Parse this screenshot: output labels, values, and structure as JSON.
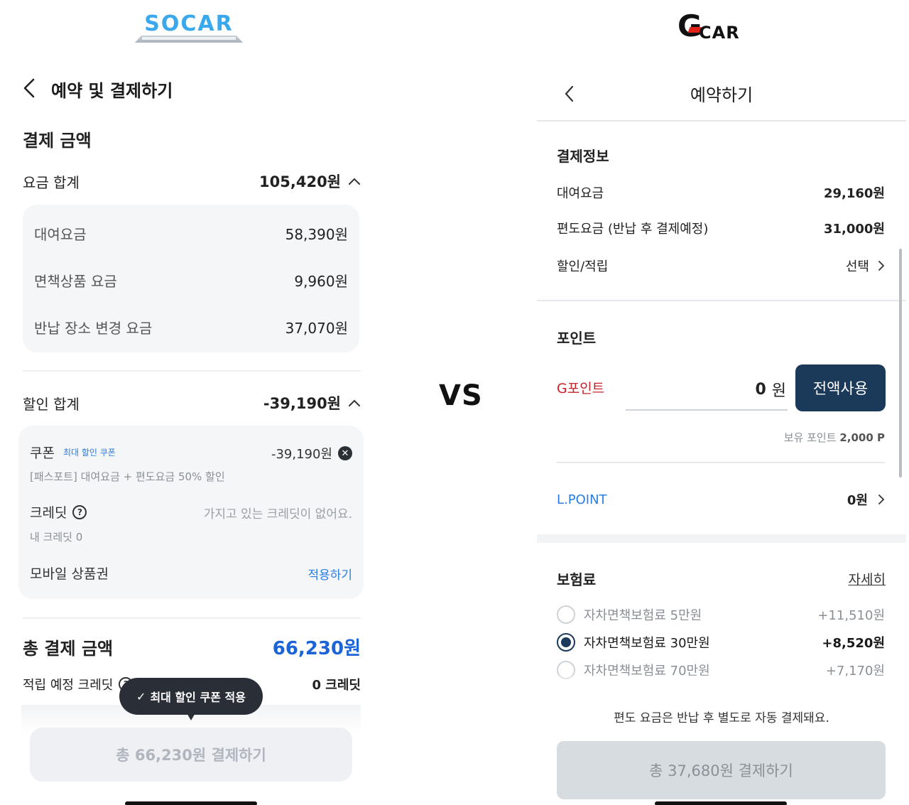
{
  "vs_label": "VS",
  "socar": {
    "logo_text": "SOCAR",
    "header_title": "예약 및 결제하기",
    "section_title": "결제 금액",
    "fee_total": {
      "label": "요금 합계",
      "amount": "105,420원"
    },
    "fee_items": [
      {
        "label": "대여요금",
        "amount": "58,390원"
      },
      {
        "label": "면책상품 요금",
        "amount": "9,960원"
      },
      {
        "label": "반납 장소 변경 요금",
        "amount": "37,070원"
      }
    ],
    "discount_total": {
      "label": "할인 합계",
      "amount": "-39,190원"
    },
    "coupon": {
      "label": "쿠폰",
      "tag": "최대 할인 쿠폰",
      "amount": "-39,190원",
      "desc": "[패스포트] 대여요금 + 편도요금 50% 할인"
    },
    "credit": {
      "label": "크레딧",
      "status": "가지고 있는 크레딧이 없어요.",
      "my_credit": "내 크레딧 0"
    },
    "mobile_voucher": {
      "label": "모바일 상품권",
      "action": "적용하기"
    },
    "grand_total": {
      "label": "총 결제 금액",
      "amount": "66,230원"
    },
    "expected_credit": {
      "label": "적립 예정 크레딧",
      "amount": "0 크레딧"
    },
    "tooltip": "최대 할인 쿠폰 적용",
    "pay_button": "총 66,230원 결제하기"
  },
  "gcar": {
    "logo_letter": "G",
    "logo_text": "CAR",
    "header_title": "예약하기",
    "payment_info": {
      "title": "결제정보",
      "rows": [
        {
          "label": "대여요금",
          "amount": "29,160원"
        },
        {
          "label": "편도요금 (반납 후 결제예정)",
          "amount": "31,000원"
        }
      ],
      "discount": {
        "label": "할인/적립",
        "action": "선택"
      }
    },
    "points": {
      "title": "포인트",
      "gpoint_label": "G포인트",
      "gpoint_value": "0",
      "gpoint_unit": "원",
      "use_all_button": "전액사용",
      "hold_label": "보유 포인트",
      "hold_value": "2,000 P",
      "lpoint_label": "L.POINT",
      "lpoint_value": "0원"
    },
    "insurance": {
      "title": "보험료",
      "detail_link": "자세히",
      "options": [
        {
          "label": "자차면책보험료 5만원",
          "price": "+11,510원",
          "selected": false
        },
        {
          "label": "자차면책보험료 30만원",
          "price": "+8,520원",
          "selected": true
        },
        {
          "label": "자차면책보험료 70만원",
          "price": "+7,170원",
          "selected": false
        }
      ]
    },
    "note": "편도 요금은 반납 후 별도로 자동 결제돼요.",
    "pay_button": "총 37,680원 결제하기"
  },
  "colors": {
    "socar_brand": "#39a8ec",
    "socar_total": "#1d63d8",
    "gcar_button": "#1b3a5a",
    "gcar_point_red": "#c8232c",
    "gcar_link_blue": "#2a7de1"
  }
}
